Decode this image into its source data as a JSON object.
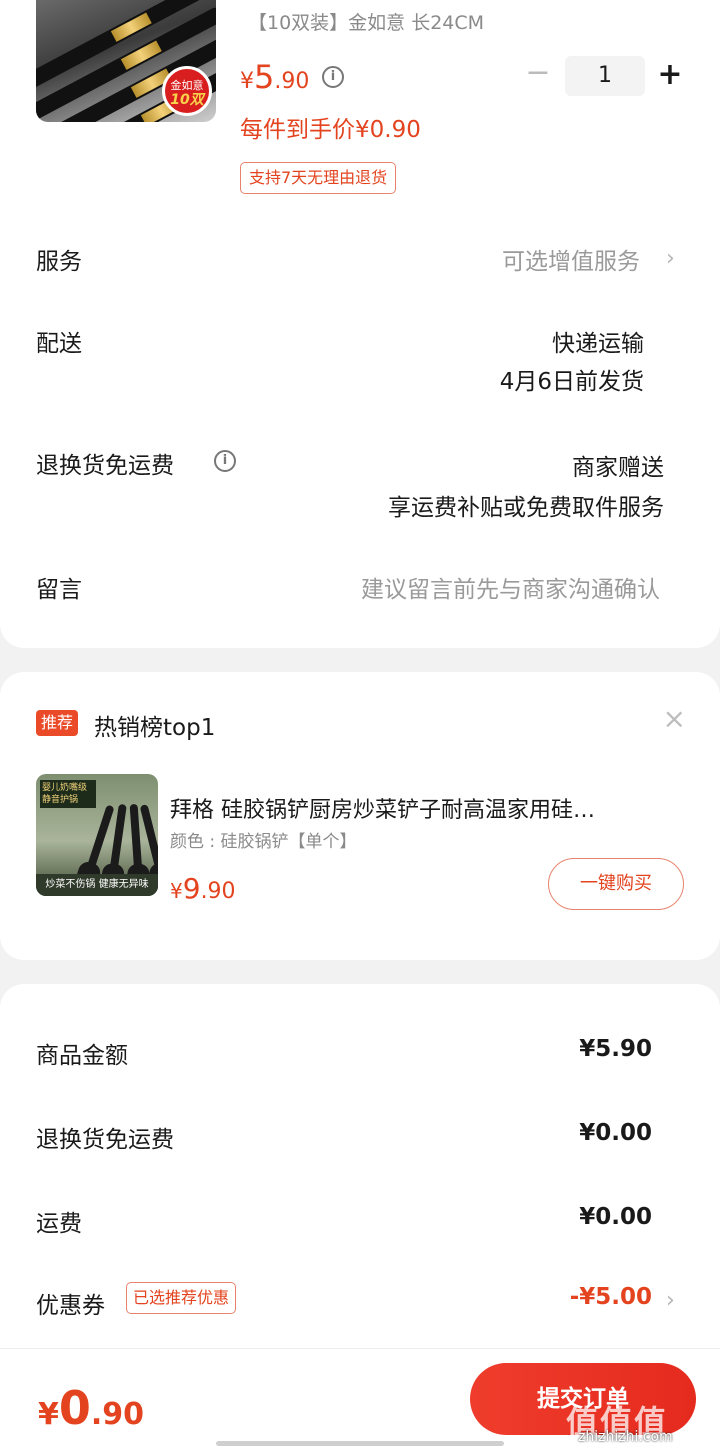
{
  "product": {
    "spec": "【10双装】金如意 长24CM",
    "image_badge_top": "金如意",
    "image_badge_bottom": "10双",
    "price_currency": "¥",
    "price_int": "5",
    "price_dec": ".90",
    "quantity": "1",
    "minus": "−",
    "plus": "+",
    "price_each": "每件到手价¥0.90",
    "return_tag": "支持7天无理由退货"
  },
  "rows": {
    "service_label": "服务",
    "service_value": "可选增值服务",
    "delivery_label": "配送",
    "delivery_value1": "快递运输",
    "delivery_value2": "4月6日前发货",
    "return_fee_label": "退换货免运费",
    "return_fee_value1": "商家赠送",
    "return_fee_value2": "享运费补贴或免费取件服务",
    "message_label": "留言",
    "message_placeholder": "建议留言前先与商家沟通确认"
  },
  "recommend": {
    "tag": "推荐",
    "title": "热销榜top1",
    "close": "×",
    "image_header": "婴儿奶嘴级 静音护锅",
    "image_caption": "炒菜不伤锅 健康无异味",
    "name": "拜格  硅胶锅铲厨房炒菜铲子耐高温家用硅…",
    "spec": "颜色 : 硅胶锅铲【单个】",
    "price_currency": "¥",
    "price_int": "9",
    "price_dec": ".90",
    "buy_label": "一键购买"
  },
  "summary": {
    "goods_label": "商品金额",
    "goods_value": "¥5.90",
    "return_label": "退换货免运费",
    "return_value": "¥0.00",
    "shipping_label": "运费",
    "shipping_value": "¥0.00",
    "coupon_label": "优惠券",
    "coupon_tag": "已选推荐优惠",
    "coupon_value": "-¥5.00"
  },
  "bottom": {
    "total_currency": "¥",
    "total_int": "0",
    "total_dec": ".90",
    "submit_label": "提交订单",
    "watermark": "值值值",
    "watermark_site": "zhizhizhi.com"
  },
  "colors": {
    "accent": "#e3441f",
    "button": "#e52a1e"
  }
}
